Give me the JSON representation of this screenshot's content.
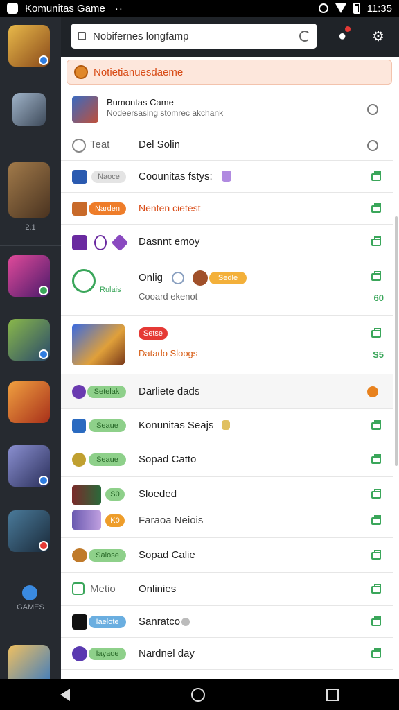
{
  "status_bar": {
    "title": "Komunitas Game",
    "dots": "··",
    "time": "11:35"
  },
  "rail": {
    "items": [
      {
        "name": "rail-game-1",
        "color": "#c98a2a",
        "badge": "#2f7de1"
      },
      {
        "name": "rail-game-2",
        "color": "#6b7f96",
        "badge": null
      },
      {
        "name": "rail-game-3",
        "color": "#7b5a3a",
        "badge": null
      },
      {
        "name": "rail-game-4",
        "color": "#b03a8a",
        "badge": "#3aa65a"
      },
      {
        "name": "rail-game-5",
        "color": "#4c8a3a",
        "badge": "#2f7de1"
      },
      {
        "name": "rail-game-6",
        "color": "#d6552a",
        "badge": null
      },
      {
        "name": "rail-game-7",
        "color": "#5a5f9a",
        "badge": "#2f7de1"
      },
      {
        "name": "rail-game-8",
        "color": "#2c4a5a",
        "badge": "#e53935"
      },
      {
        "name": "rail-game-9",
        "color": "#e0a030",
        "badge": null
      }
    ],
    "caption_1": "2.1",
    "caption_2": "GAMES"
  },
  "toolbar": {
    "search_text": "Nobifernes longfamp"
  },
  "banner": {
    "text": "Notietianuesdaeme"
  },
  "rows": [
    {
      "label": "Bumontas Came",
      "sub": "Nodeersasing stomrec akchank"
    },
    {
      "pre": "Teat",
      "label": "Del Solin"
    },
    {
      "pill": "Naoce",
      "label": "Coounitas fstys:"
    },
    {
      "pill": "Narden",
      "label": "Nenten cietest"
    },
    {
      "label": "Dasnnt emoy"
    },
    {
      "side": "Rulais",
      "label": "Onlig",
      "pill": "Sedle",
      "sub": "Cooard ekenot",
      "count": "60"
    },
    {
      "pill": "Setse",
      "sub": "Datado Sloogs",
      "count": "S5"
    },
    {
      "pill": "Setelak",
      "label": "Darliete dads"
    },
    {
      "pill": "Seaue",
      "label": "Konunitas Seajs"
    },
    {
      "pill": "Seaue",
      "label": "Sopad Catto"
    },
    {
      "pill": "S0",
      "label": "Sloeded"
    },
    {
      "pill": "K0",
      "label": "Faraoa Neiois"
    },
    {
      "pill": "Salose",
      "label": "Sopad Calie"
    },
    {
      "pre": "Metio",
      "label": "Onlinies"
    },
    {
      "pill": "Iaelote",
      "label": "Sanratco"
    },
    {
      "pill": "Iayaoe",
      "label": "Nardnel day"
    }
  ]
}
